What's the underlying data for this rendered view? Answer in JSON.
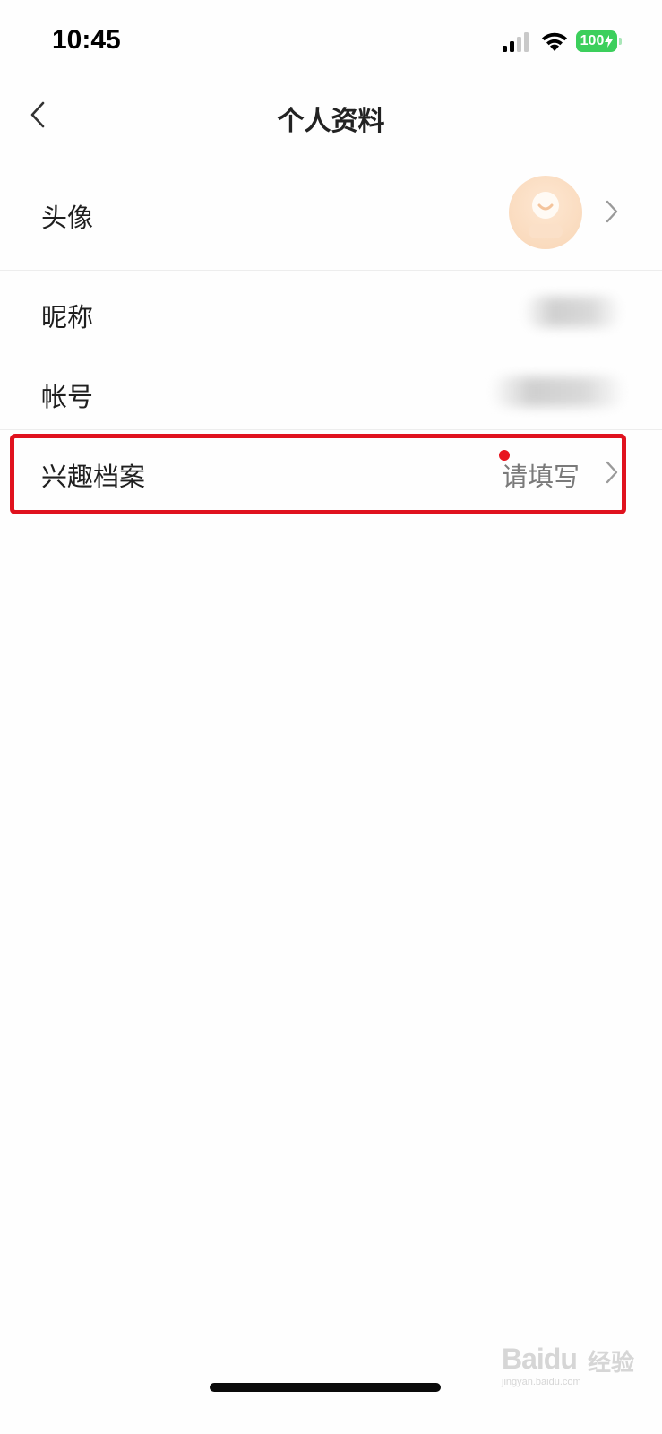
{
  "status_bar": {
    "time": "10:45",
    "battery_level": "100",
    "icons": [
      "signal-icon",
      "wifi-icon",
      "battery-icon",
      "charging-icon"
    ],
    "battery_color": "#3ccf5c"
  },
  "nav": {
    "title": "个人资料",
    "back_icon": "chevron-left-icon"
  },
  "rows": {
    "avatar": {
      "label": "头像"
    },
    "nickname": {
      "label": "昵称"
    },
    "account": {
      "label": "帐号"
    },
    "interest": {
      "label": "兴趣档案",
      "value": "请填写",
      "has_notification_dot": true
    }
  },
  "annotation": {
    "highlight_color": "#e0121e",
    "highlighted_row": "兴趣档案"
  },
  "watermark": {
    "logo": "Baidu",
    "text": "经验",
    "url": "jingyan.baidu.com"
  },
  "colors": {
    "accent_red": "#e8141e",
    "text_primary": "#1f1f1f",
    "text_secondary": "#7a7a7a",
    "avatar_bg": "#f9d6b6"
  }
}
